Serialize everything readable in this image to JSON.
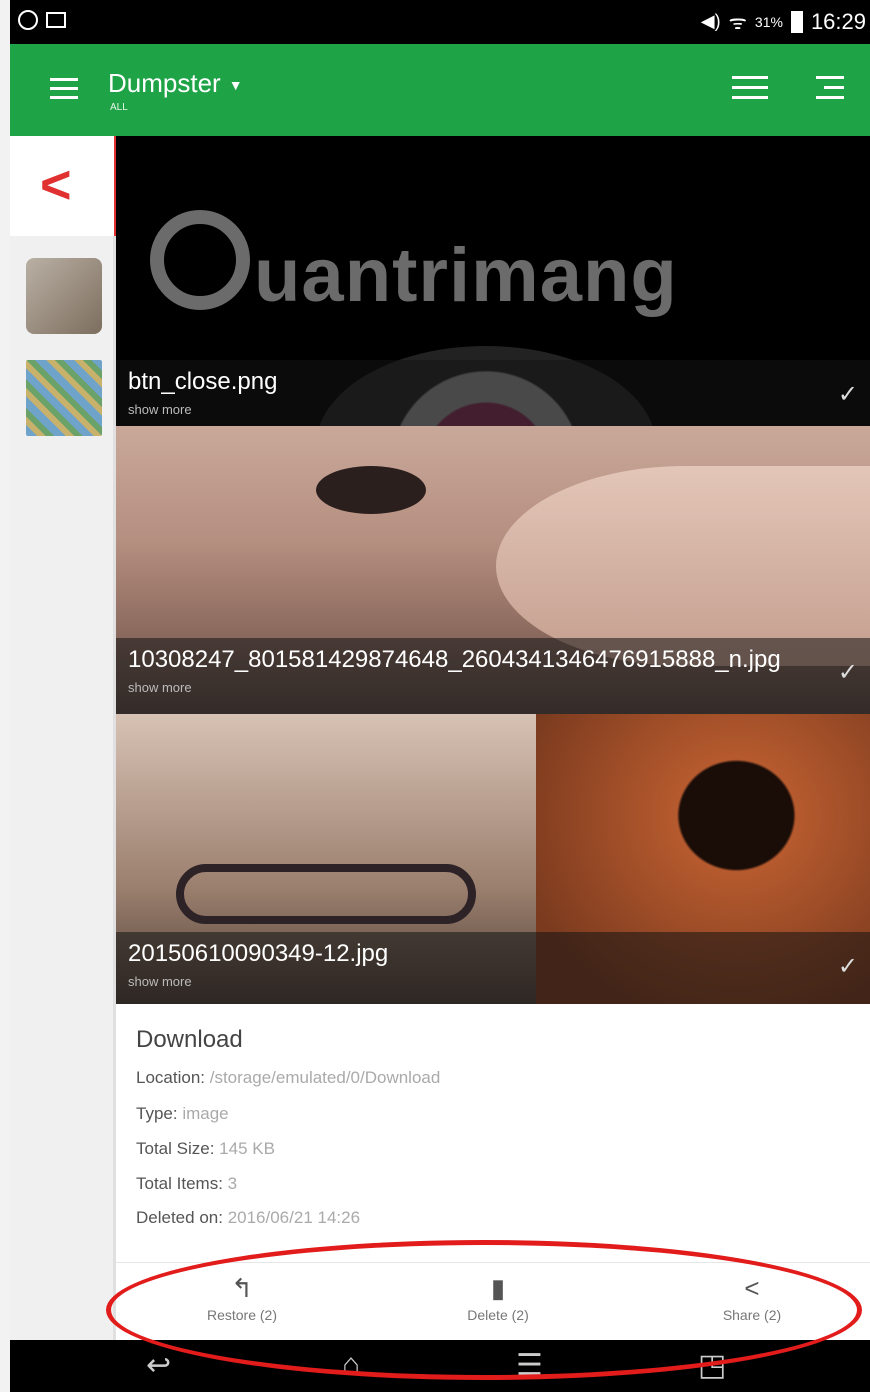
{
  "status_bar": {
    "battery": "31%",
    "time": "16:29"
  },
  "app_bar": {
    "title": "Dumpster",
    "subtitle": "ALL"
  },
  "sidebar": {
    "back_glyph": "<"
  },
  "watermark": {
    "text": "uantrimang"
  },
  "files": [
    {
      "name": "btn_close.png",
      "more": "show more"
    },
    {
      "name": "10308247_801581429874648_2604341346476915888_n.jpg",
      "more": "show more"
    },
    {
      "name": "20150610090349-12.jpg",
      "more": "show more"
    }
  ],
  "details": {
    "heading": "Download",
    "location_label": "Location:",
    "location_value": "/storage/emulated/0/Download",
    "type_label": "Type:",
    "type_value": "image",
    "size_label": "Total Size:",
    "size_value": "145 KB",
    "items_label": "Total Items:",
    "items_value": "3",
    "deleted_label": "Deleted on:",
    "deleted_value": "2016/06/21 14:26"
  },
  "actions": {
    "restore": "Restore (2)",
    "delete": "Delete (2)",
    "share": "Share (2)"
  },
  "colors": {
    "appbar": "#1ea447",
    "accent_red": "#e21b1b"
  }
}
